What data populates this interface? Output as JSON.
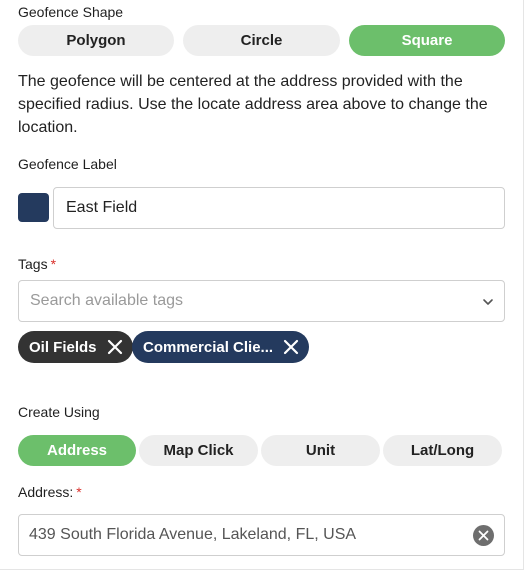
{
  "shape": {
    "label": "Geofence Shape",
    "options": [
      "Polygon",
      "Circle",
      "Square"
    ],
    "selected": "Square"
  },
  "description": "The geofence will be centered at the address provided with the specified radius. Use the locate address area above to change the location.",
  "label_section": {
    "label": "Geofence Label",
    "value": "East Field",
    "swatch_color": "#243a5e"
  },
  "tags": {
    "label": "Tags",
    "required_mark": "*",
    "placeholder": "Search available tags",
    "chips": [
      {
        "label": "Oil Fields",
        "color": "#333333"
      },
      {
        "label": "Commercial Clie...",
        "color": "#243a5e"
      }
    ]
  },
  "create_using": {
    "label": "Create Using",
    "options": [
      "Address",
      "Map Click",
      "Unit",
      "Lat/Long"
    ],
    "selected": "Address"
  },
  "address": {
    "label": "Address:",
    "required_mark": "*",
    "value": "439 South Florida Avenue, Lakeland, FL, USA"
  },
  "colors": {
    "accent_green": "#6cbf6b",
    "navy": "#243a5e",
    "required_red": "#d9302b"
  }
}
